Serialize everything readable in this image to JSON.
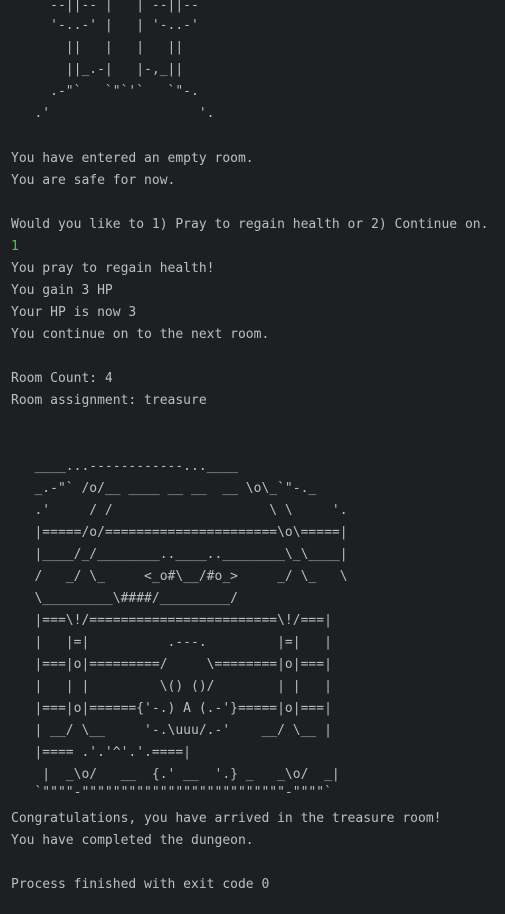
{
  "console": {
    "art_top": [
      "     --||-- |   | --||--",
      "     '-..-' |   | '-..-'",
      "       ||   |   |   ||",
      "       ||_.-|   |-,_||",
      "     .-\"`   `\"`'`   `\"-.",
      "   .'                   '."
    ],
    "messages_1": [
      "You have entered an empty room.",
      "You are safe for now."
    ],
    "prompt": "Would you like to 1) Pray to regain health or 2) Continue on.",
    "user_input": "1",
    "messages_2": [
      "You pray to regain health!",
      "You gain 3 HP",
      "Your HP is now 3",
      "You continue on to the next room."
    ],
    "room_count": "Room Count: 4",
    "room_assignment": "Room assignment: treasure",
    "treasure_art": [
      "   ____...------------...____",
      "   _.-\"` /o/__ ____ __ __  __ \\o\\_`\"-._",
      "   .'     / /                    \\ \\     '.",
      "   |=====/o/======================\\o\\=====|",
      "   |____/_/________..____..________\\_\\____|",
      "   /   _/ \\_     <_o#\\__/#o_>     _/ \\_   \\",
      "   \\_________\\####/_________/",
      "   |===\\!/========================\\!/===|",
      "   |   |=|          .---.         |=|   |",
      "   |===|o|=========/     \\========|o|===|",
      "   |   | |         \\() ()/        | |   |",
      "   |===|o|======{'-.) A (.-'}=====|o|===|",
      "   | __/ \\__     '-.\\uuu/.-'    __/ \\__ |",
      "   |==== .'.'^'.'.====|",
      "    |  _\\o/   __  {.' __  '.} _   _\\o/  _|",
      "   `\"\"\"\"-\"\"\"\"\"\"\"\"\"\"\"\"\"\"\"\"\"\"\"\"\"\"\"\"\"\"-\"\"\"\"`"
    ],
    "final_messages": [
      "Congratulations, you have arrived in the treasure room!",
      "You have completed the dungeon."
    ],
    "exit_message": "Process finished with exit code 0",
    "colors": {
      "background": "#1e1f22",
      "text": "#bcbec4",
      "user_input": "#5fb865"
    }
  }
}
